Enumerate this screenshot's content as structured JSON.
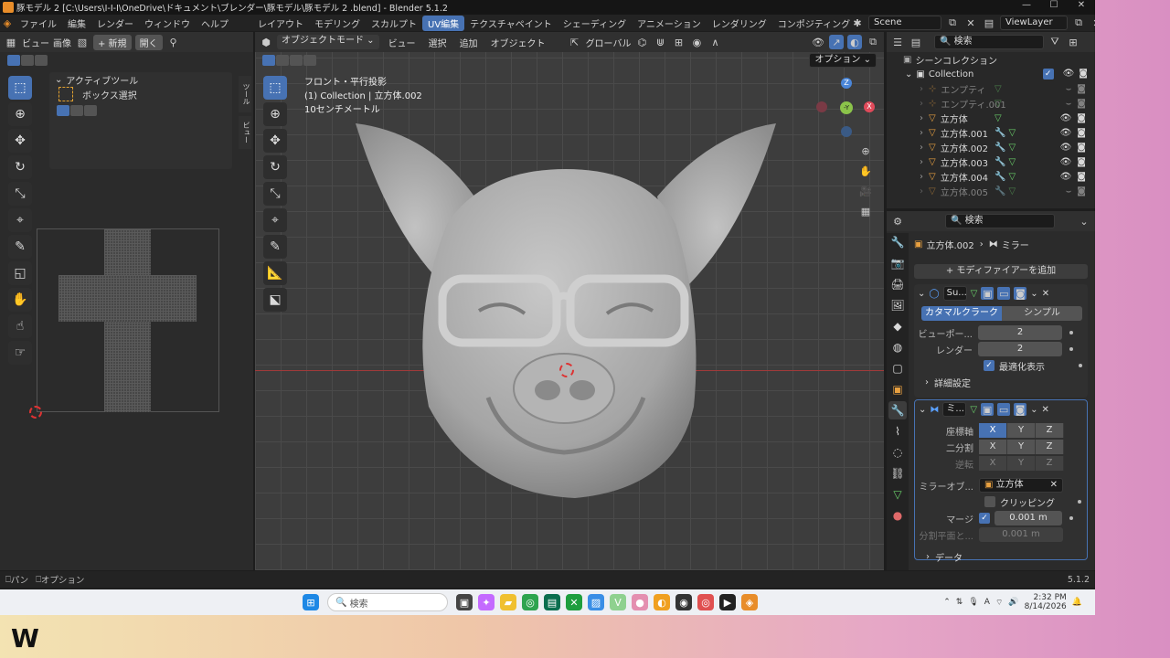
{
  "title": {
    "text": "豚モデル 2 [C:\\Users\\I-I-I\\OneDrive\\ドキュメント\\ブレンダー\\豚モデル\\豚モデル 2 .blend] - Blender 5.1.2",
    "minimize": "—",
    "maximize": "☐",
    "close": "✕"
  },
  "menu": [
    "ファイル",
    "編集",
    "レンダー",
    "ウィンドウ",
    "ヘルプ"
  ],
  "workspaces": [
    "レイアウト",
    "モデリング",
    "スカルプト",
    "UV編集",
    "テクスチャペイント",
    "シェーディング",
    "アニメーション",
    "レンダリング",
    "コンポジティング"
  ],
  "active_workspace_index": 3,
  "scene": {
    "name": "Scene",
    "view_layer": "ViewLayer"
  },
  "uv_editor": {
    "view": "ビュー",
    "image": "画像",
    "new_btn": "+ 新規",
    "open_btn": "開く",
    "active_tool_title": "アクティブツール",
    "box_select": "ボックス選択",
    "side_tab_tool": "ツール",
    "side_tab_view": "ビュー"
  },
  "viewport": {
    "mode": "オブジェクトモード",
    "menus": [
      "ビュー",
      "選択",
      "追加",
      "オブジェクト"
    ],
    "orientation": "グローバル",
    "options": "オプション",
    "info_line1": "フロント・平行投影",
    "info_line2": "(1) Collection | 立方体.002",
    "info_line3": "10センチメートル",
    "gizmo_z": "Z",
    "gizmo_y": "-Y",
    "gizmo_x": "X"
  },
  "outliner": {
    "search_placeholder": "検索",
    "scene_collection": "シーンコレクション",
    "collection": "Collection",
    "items": [
      {
        "name": "エンプティ",
        "dim": true,
        "mod": false
      },
      {
        "name": "エンプティ.001",
        "dim": true,
        "mod": false
      },
      {
        "name": "立方体",
        "dim": false,
        "mod": false
      },
      {
        "name": "立方体.001",
        "dim": false,
        "mod": true
      },
      {
        "name": "立方体.002",
        "dim": false,
        "mod": true
      },
      {
        "name": "立方体.003",
        "dim": false,
        "mod": true
      },
      {
        "name": "立方体.004",
        "dim": false,
        "mod": true
      },
      {
        "name": "立方体.005",
        "dim": true,
        "mod": true
      }
    ]
  },
  "properties": {
    "search_placeholder": "検索",
    "object": "立方体.002",
    "modifier": "ミラー",
    "add_modifier": "+ モディファイアーを追加",
    "subsurf": {
      "name": "Su...",
      "catmull": "カタマルクラーク",
      "simple": "シンプル",
      "viewport_label": "ビューポー...",
      "viewport_val": "2",
      "render_label": "レンダー",
      "render_val": "2",
      "optimal": "最適化表示",
      "advanced": "詳細設定"
    },
    "mirror": {
      "name": "ミ...",
      "axis_label": "座標軸",
      "bisect_label": "二分割",
      "flip_label": "逆転",
      "x": "X",
      "y": "Y",
      "z": "Z",
      "mirror_obj_label": "ミラーオブ...",
      "mirror_obj": "立方体",
      "clipping": "クリッピング",
      "merge_label": "マージ",
      "merge_val": "0.001 m",
      "bisect_dist_label": "分割平面と...",
      "bisect_dist_val": "0.001 m",
      "data": "データ"
    }
  },
  "status": {
    "pan": "パン",
    "options": "オプション",
    "version": "5.1.2"
  },
  "taskbar": {
    "search": "検索",
    "time": "2:32 PM",
    "date": "8/14/2026"
  },
  "watermark": "W"
}
